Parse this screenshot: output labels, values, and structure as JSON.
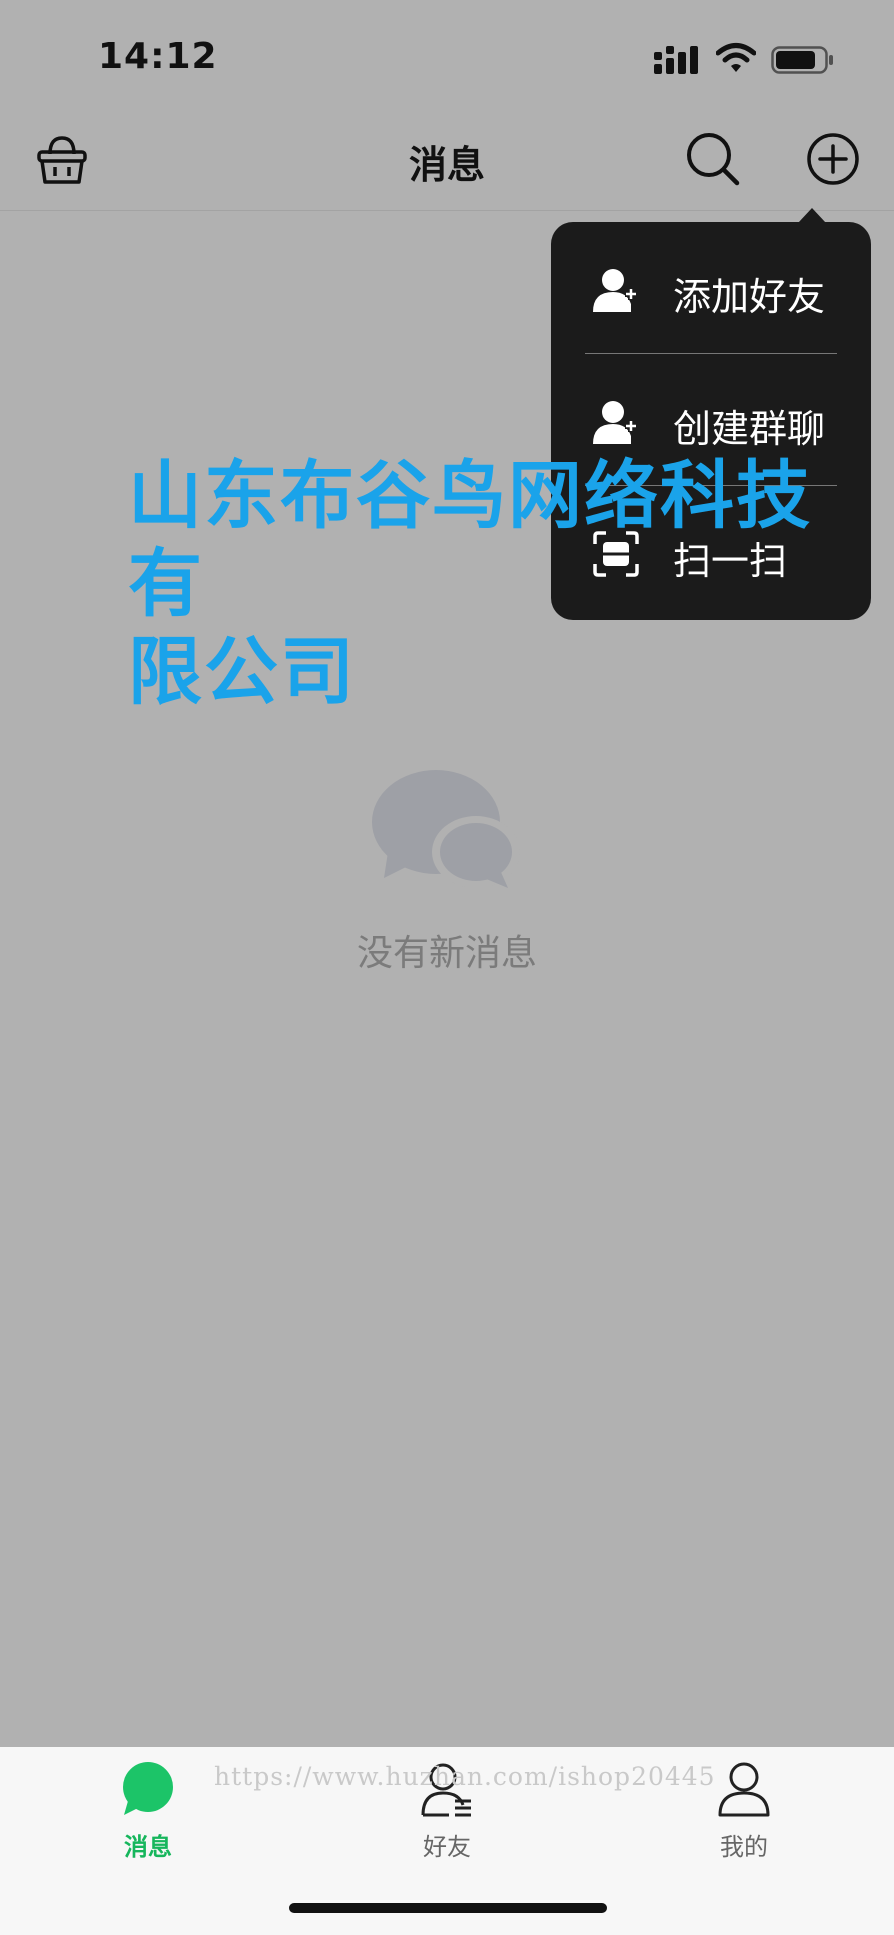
{
  "status_bar": {
    "time": "14:12"
  },
  "nav": {
    "title": "消息",
    "left_icon": "basket-icon",
    "search_icon": "search-icon",
    "add_icon": "plus-circle-icon"
  },
  "menu": {
    "items": [
      {
        "label": "添加好友",
        "icon": "add-user-icon"
      },
      {
        "label": "创建群聊",
        "icon": "add-group-icon"
      },
      {
        "label": "扫一扫",
        "icon": "scan-icon"
      }
    ]
  },
  "watermark": {
    "line1": "山东布谷鸟网络科技有",
    "line2": "限公司",
    "url": "https://www.huzhan.com/ishop20445"
  },
  "empty": {
    "text": "没有新消息",
    "icon": "chat-bubbles-icon"
  },
  "tabbar": {
    "active_color": "#16b65c",
    "tabs": [
      {
        "label": "消息",
        "icon": "message-icon",
        "active": true
      },
      {
        "label": "好友",
        "icon": "friends-icon",
        "active": false
      },
      {
        "label": "我的",
        "icon": "profile-icon",
        "active": false
      }
    ]
  }
}
